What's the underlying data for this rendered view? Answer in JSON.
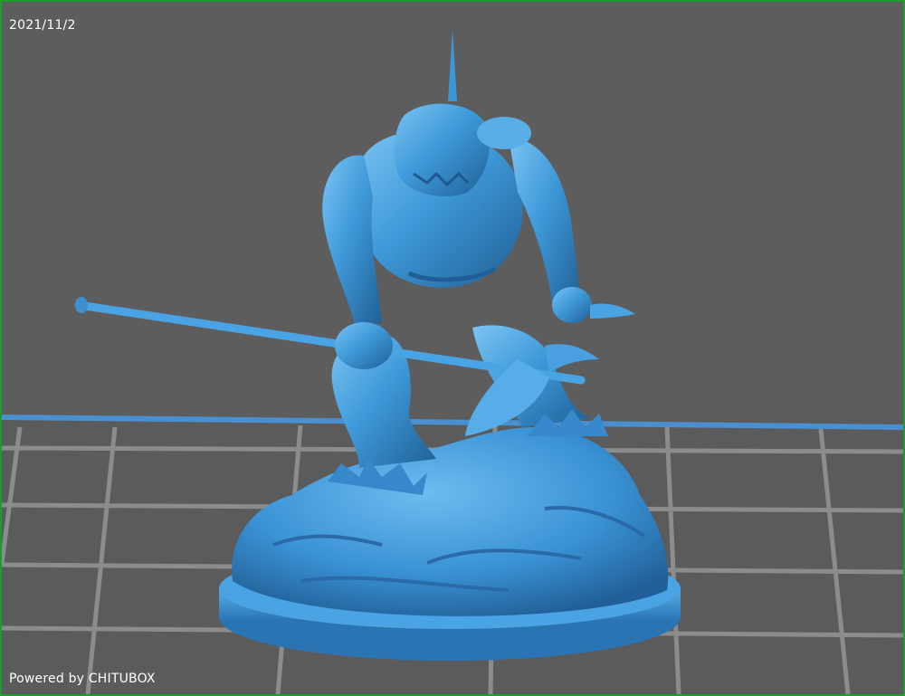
{
  "viewport": {
    "date": "2021/11/2",
    "watermark": "Powered by CHITUBOX"
  },
  "scene": {
    "model_color": "#3f9ad9",
    "model_highlight": "#7cc4f4",
    "model_shadow": "#1f5f96",
    "background_color": "#5d5d5d",
    "grid_color": "#8c8c8c",
    "horizon_color": "#4a8fd0",
    "frame_color": "#1f9a2e"
  }
}
